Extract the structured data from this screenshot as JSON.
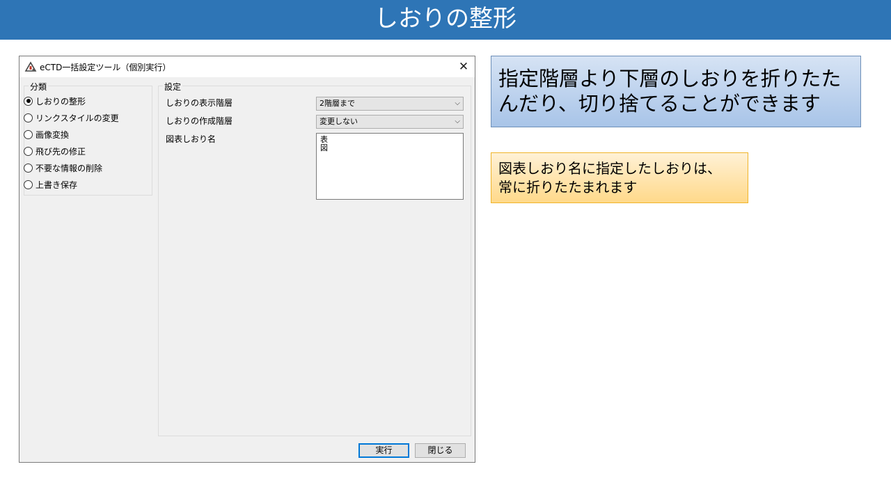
{
  "slide": {
    "title": "しおりの整形"
  },
  "window": {
    "title": "eCTD一括設定ツール（個別実行）",
    "close_glyph": "✕",
    "category_group": {
      "label": "分類",
      "options": [
        {
          "label": "しおりの整形",
          "checked": true
        },
        {
          "label": "リンクスタイルの変更",
          "checked": false
        },
        {
          "label": "画像変換",
          "checked": false
        },
        {
          "label": "飛び先の修正",
          "checked": false
        },
        {
          "label": "不要な情報の削除",
          "checked": false
        },
        {
          "label": "上書き保存",
          "checked": false
        }
      ]
    },
    "settings_group": {
      "label": "設定",
      "display_level_label": "しおりの表示階層",
      "display_level_value": "2階層まで",
      "create_level_label": "しおりの作成階層",
      "create_level_value": "変更しない",
      "figure_bookmark_label": "図表しおり名",
      "figure_bookmark_lines": [
        "表",
        "図"
      ]
    },
    "buttons": {
      "run": "実行",
      "close": "閉じる"
    }
  },
  "callouts": {
    "blue_lines": [
      "指定階層より下層のしおりを折りたた",
      "んだり、切り捨てることができます"
    ],
    "orange_lines": [
      "図表しおり名に指定したしおりは、",
      "常に折りたたまれます"
    ]
  },
  "colors": {
    "header": "#2e75b6",
    "primary_button_border": "#0078d7",
    "callout_blue": "#a8c4e8",
    "callout_orange": "#ffd98a"
  }
}
